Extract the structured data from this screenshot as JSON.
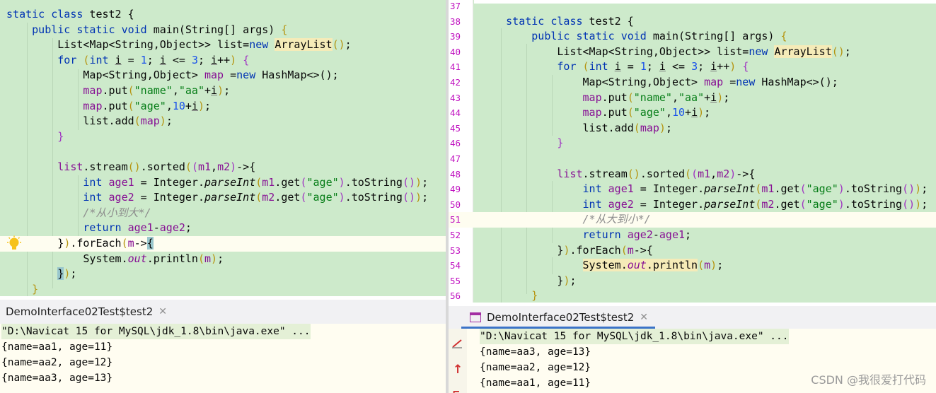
{
  "left": {
    "code_lines": [
      "static class test2 {",
      "    public static void main(String[] args) {",
      "        List<Map<String,Object>> list=new ArrayList();",
      "        for (int i = 1; i <= 3; i++) {",
      "            Map<String,Object> map =new HashMap<>();",
      "            map.put(\"name\",\"aa\"+i);",
      "            map.put(\"age\",10+i);",
      "            list.add(map);",
      "        }",
      "",
      "        list.stream().sorted((m1,m2)->{",
      "            int age1 = Integer.parseInt(m1.get(\"age\").toString());",
      "            int age2 = Integer.parseInt(m2.get(\"age\").toString());",
      "            /*从小到大*/",
      "            return age1-age2;",
      "        }).forEach(m->{",
      "            System.out.println(m);",
      "        });",
      "    }"
    ],
    "run_tab": "DemoInterface02Test$test2",
    "console": [
      "\"D:\\Navicat 15 for MySQL\\jdk_1.8\\bin\\java.exe\" ...",
      "{name=aa1, age=11}",
      "{name=aa2, age=12}",
      "{name=aa3, age=13}"
    ]
  },
  "right": {
    "line_numbers": [
      "37",
      "38",
      "39",
      "40",
      "41",
      "42",
      "43",
      "44",
      "45",
      "46",
      "47",
      "48",
      "49",
      "50",
      "51",
      "52",
      "53",
      "54",
      "55",
      "56"
    ],
    "code_lines": [
      "",
      "static class test2 {",
      "    public static void main(String[] args) {",
      "        List<Map<String,Object>> list=new ArrayList();",
      "        for (int i = 1; i <= 3; i++) {",
      "            Map<String,Object> map =new HashMap<>();",
      "            map.put(\"name\",\"aa\"+i);",
      "            map.put(\"age\",10+i);",
      "            list.add(map);",
      "        }",
      "",
      "        list.stream().sorted((m1,m2)->{",
      "            int age1 = Integer.parseInt(m1.get(\"age\").toString());",
      "            int age2 = Integer.parseInt(m2.get(\"age\").toString());",
      "            /*从大到小*/",
      "            return age2-age1;",
      "        }).forEach(m->{",
      "            System.out.println(m);",
      "        });",
      "    }"
    ],
    "run_tab": "DemoInterface02Test$test2",
    "console": [
      "\"D:\\Navicat 15 for MySQL\\jdk_1.8\\bin\\java.exe\" ...",
      "{name=aa3, age=13}",
      "{name=aa2, age=12}",
      "{name=aa1, age=11}"
    ]
  },
  "watermark": "CSDN @我很爱打代码",
  "icons": {
    "bulb": "lightbulb-icon",
    "stop": "stop-icon",
    "rerun": "rerun-arrow-icon",
    "close": "close-icon",
    "run": "run-config-icon"
  },
  "colors": {
    "editor_bg": "#cdeacb",
    "keyword": "#0033b3",
    "string": "#067d17",
    "number": "#1750eb",
    "field": "#871094",
    "console_bg": "#fffdf1",
    "tab_underline": "#3b73c8"
  }
}
